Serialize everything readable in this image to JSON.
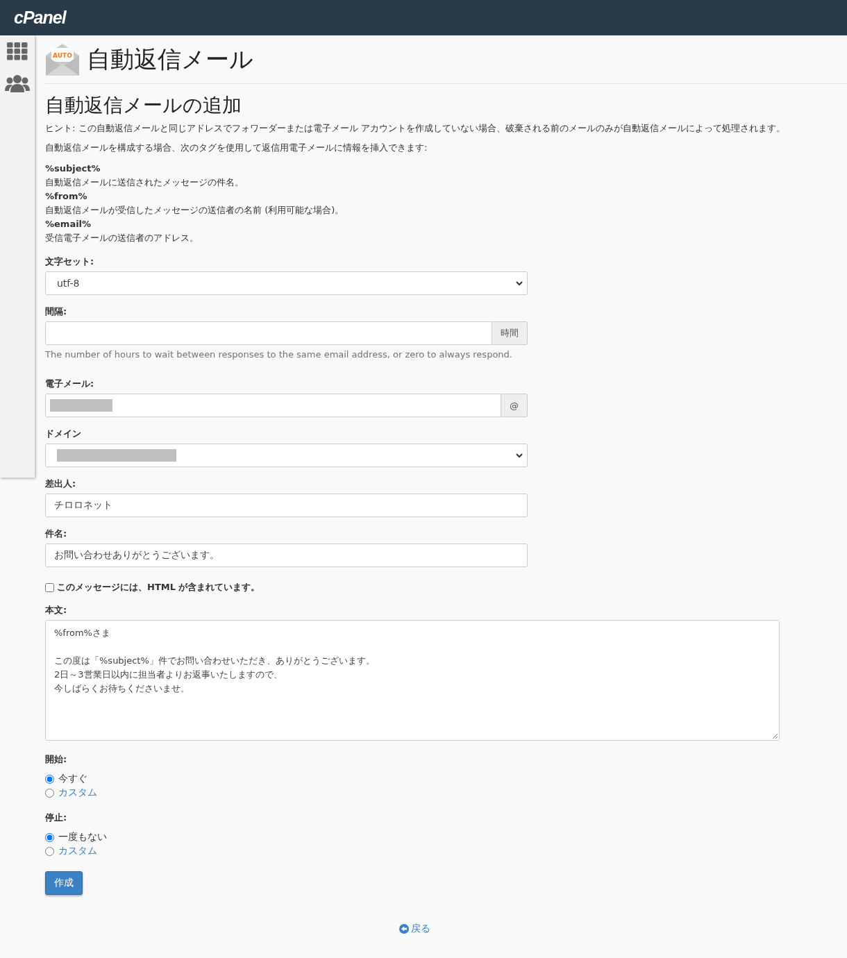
{
  "header": {
    "logo": "cPanel"
  },
  "page": {
    "title": "自動返信メール",
    "icon_badge": "AUTO"
  },
  "section": {
    "title": "自動返信メールの追加",
    "hint": "ヒント: この自動返信メールと同じアドレスでフォワーダーまたは電子メール アカウントを作成していない場合、破棄される前のメールのみが自動返信メールによって処理されます。",
    "intro": "自動返信メールを構成する場合、次のタグを使用して返信用電子メールに情報を挿入できます:",
    "tags": [
      {
        "tag": "%subject%",
        "description": "自動返信メールに送信されたメッセージの件名。"
      },
      {
        "tag": "%from%",
        "description": "自動返信メールが受信したメッセージの送信者の名前 (利用可能な場合)。"
      },
      {
        "tag": "%email%",
        "description": "受信電子メールの送信者のアドレス。"
      }
    ]
  },
  "form": {
    "charset": {
      "label": "文字セット:",
      "value": "utf-8"
    },
    "interval": {
      "label": "間隔:",
      "addon": "時間",
      "help": "The number of hours to wait between responses to the same email address, or zero to always respond."
    },
    "email": {
      "label": "電子メール:",
      "addon": "@",
      "redacted": true
    },
    "domain": {
      "label": "ドメイン",
      "redacted": true
    },
    "from": {
      "label": "差出人:",
      "value": "チロロネット"
    },
    "subject": {
      "label": "件名:",
      "value": "お問い合わせありがとうございます。"
    },
    "html": {
      "label": "このメッセージには、HTML が含まれています。",
      "checked": false
    },
    "body": {
      "label": "本文:",
      "paragraphs": [
        [
          "%from%さま"
        ],
        [
          "この度は「%subject%」件でお問い合わせいただき、ありがとうございます。",
          "2日～3営業日以内に担当者よりお返事いたしますので、",
          "今しばらくお待ちくださいませ。"
        ]
      ]
    },
    "start": {
      "label": "開始:",
      "options": [
        {
          "label": "今すぐ",
          "selected": true
        },
        {
          "label": "カスタム",
          "selected": false
        }
      ]
    },
    "stop": {
      "label": "停止:",
      "options": [
        {
          "label": "一度もない",
          "selected": true
        },
        {
          "label": "カスタム",
          "selected": false
        }
      ]
    },
    "submit": "作成"
  },
  "back_link": "戻る"
}
